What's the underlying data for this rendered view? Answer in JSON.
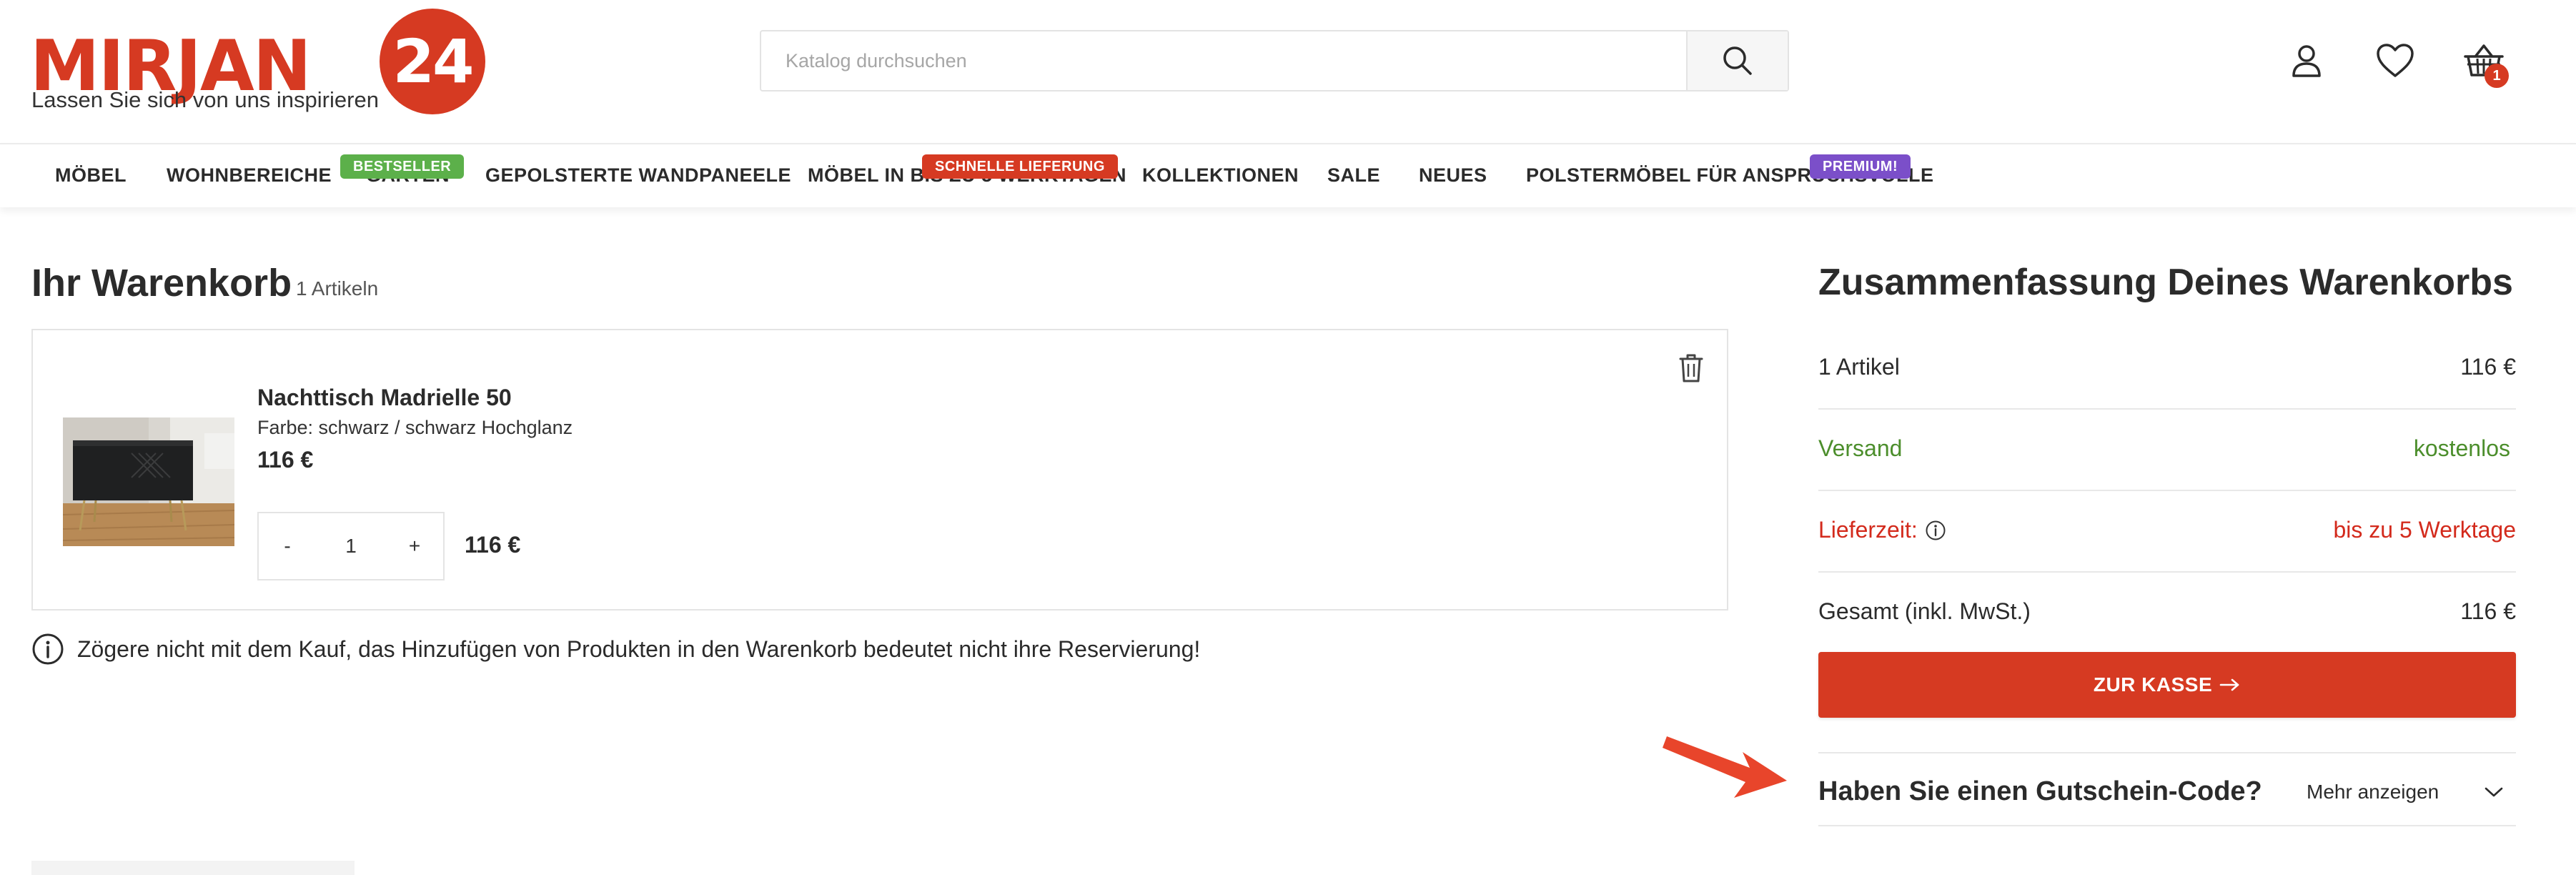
{
  "brand": {
    "logo_word": "MIRJAN",
    "logo_number": "24",
    "tagline": "Lassen Sie sich von uns inspirieren",
    "color": "#d63a22"
  },
  "search": {
    "placeholder": "Katalog durchsuchen",
    "icon": "search-icon"
  },
  "header_icons": {
    "account": "user-icon",
    "wishlist": "heart-icon",
    "cart": "basket-icon",
    "cart_count": "1"
  },
  "nav": {
    "items": [
      {
        "label": "MÖBEL"
      },
      {
        "label": "WOHNBEREICHE"
      },
      {
        "label": "GARTEN",
        "badge": "BESTSELLER",
        "badge_color": "#5cb04a"
      },
      {
        "label": "GEPOLSTERTE WANDPANEELE"
      },
      {
        "label": "MÖBEL IN BIS ZU 5 WERKTAGEN",
        "badge": "SCHNELLE LIEFERUNG",
        "badge_color": "#d63a22"
      },
      {
        "label": "KOLLEKTIONEN"
      },
      {
        "label": "SALE"
      },
      {
        "label": "NEUES"
      },
      {
        "label": "POLSTERMÖBEL FÜR ANSPRUCHSVOLLE",
        "badge": "PREMIUM!",
        "badge_color": "#7b4fc9"
      }
    ]
  },
  "cart": {
    "title": "Ihr Warenkorb",
    "count_label": "1 Artikeln",
    "item": {
      "name": "Nachttisch Madrielle 50",
      "color_label": "Farbe: schwarz / schwarz Hochglanz",
      "price": "116 €",
      "qty_minus": "-",
      "qty": "1",
      "qty_plus": "+",
      "line_total": "116 €",
      "delete_icon": "trash-icon"
    },
    "notice": "Zögere nicht mit dem Kauf, das Hinzufügen von Produkten in den Warenkorb bedeutet nicht ihre Reservierung!"
  },
  "summary": {
    "title": "Zusammenfassung Deines Warenkorbs",
    "items_label": "1 Artikel",
    "items_value": "116 €",
    "shipping_label": "Versand",
    "shipping_value": "kostenlos",
    "delivery_label": "Lieferzeit:",
    "delivery_value": "bis zu 5 Werktage",
    "total_label": "Gesamt (inkl. MwSt.)",
    "total_value": "116 €",
    "checkout_label": "ZUR KASSE",
    "coupon_title": "Haben Sie einen Gutschein-Code?",
    "coupon_more": "Mehr anzeigen",
    "green_color": "#4c8e2c",
    "red_color": "#d32a1c"
  }
}
